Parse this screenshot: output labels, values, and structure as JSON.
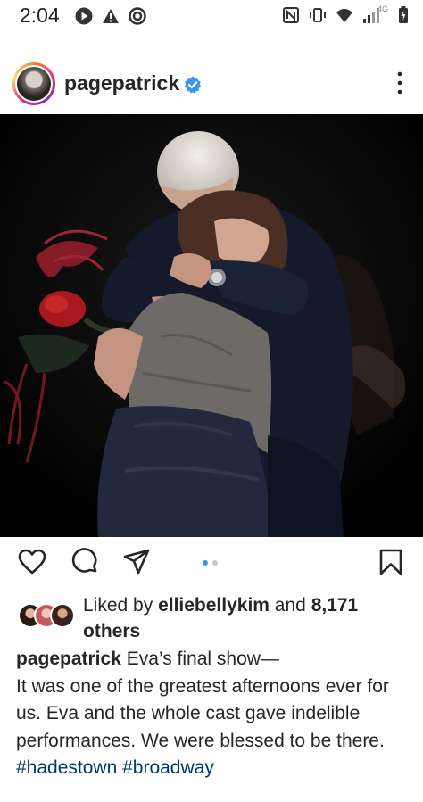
{
  "status_bar": {
    "time": "2:04",
    "network_label": "4G"
  },
  "post": {
    "username": "pagepatrick",
    "verified": true,
    "photo_alt": "",
    "carousel": {
      "count": 2,
      "active": 1
    },
    "likes": {
      "prefix": "Liked by ",
      "liker": "elliebellykim",
      "middle": " and ",
      "count": "8,171",
      "suffix": " others"
    },
    "caption": {
      "username": "pagepatrick",
      "first_line": " Eva’s final show—",
      "body": "It was one of the greatest afternoons ever for us. Eva and the whole cast gave indelible performances. We were blessed to be there.",
      "hashtags": "#hadestown #broadway"
    }
  },
  "colors": {
    "text": "#262626",
    "link": "#00376b",
    "accent": "#3897f0",
    "verified": "#3897f0"
  },
  "icons": [
    "play-icon",
    "warning-icon",
    "target-icon",
    "nfc-icon",
    "vibrate-icon",
    "wifi-icon",
    "signal-icon",
    "battery-icon",
    "verified-icon",
    "more-options-icon",
    "heart-icon",
    "comment-icon",
    "share-icon",
    "bookmark-icon"
  ]
}
